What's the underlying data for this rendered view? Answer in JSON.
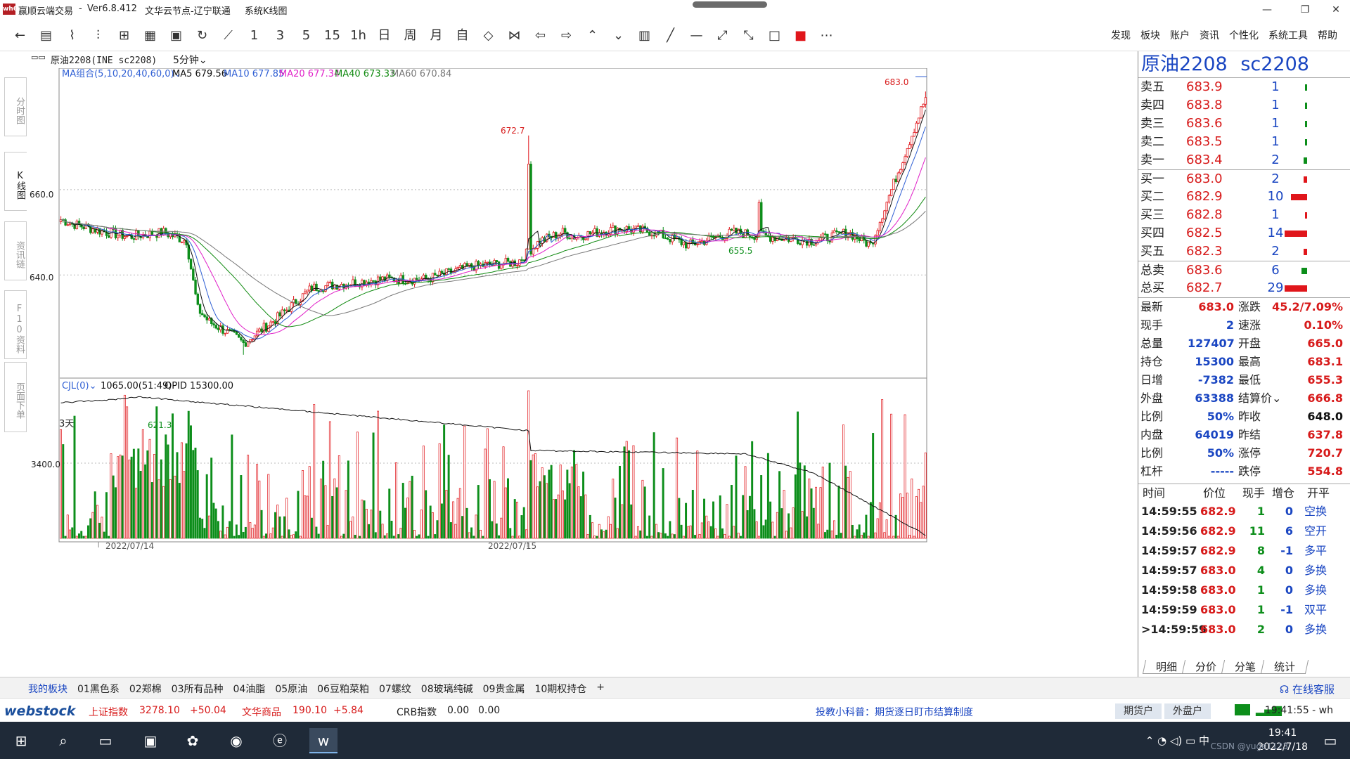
{
  "window": {
    "logo_text": "wh6",
    "app_name": "赢顺云端交易",
    "version": "Ver6.8.412",
    "node": "文华云节点-辽宁联通",
    "view": "系统K线图",
    "min": "—",
    "max": "❐",
    "close": "✕"
  },
  "toolbar": {
    "icons": [
      "←",
      "▤",
      "⌇",
      "⫶",
      "⊞",
      "▦",
      "▣",
      "↻",
      "⟋",
      "1",
      "3",
      "5",
      "15",
      "1h",
      "日",
      "周",
      "月",
      "自",
      "◇",
      "⋈",
      "⇦",
      "⇨",
      "⌃",
      "⌄",
      "▥",
      "╱",
      "—",
      "⤢",
      "⤡",
      "□",
      "■",
      "⋯"
    ],
    "menu": [
      "发现",
      "板块",
      "账户",
      "资讯",
      "个性化",
      "系统工具",
      "帮助"
    ]
  },
  "side_tabs": [
    "分时图",
    "K线图",
    "资讯链",
    "F10资料",
    "页面下单"
  ],
  "chart_header": {
    "symbol": "原油2208(INE sc2208)",
    "period": "5分钟⌄",
    "ma_title": "MA组合(5,10,20,40,60,0)⌄",
    "ma5": "MA5  679.56",
    "ma10": "MA10  677.85",
    "ma20": "MA20  677.34",
    "ma40": "MA40  673.33",
    "ma60": "MA60  670.84"
  },
  "chart_data": {
    "type": "candlestick",
    "price_axis_ticks": [
      "660.0",
      "640.0"
    ],
    "price_ticks_values": [
      660,
      640
    ],
    "price_range": [
      616,
      686
    ],
    "high_label": "683.0",
    "spike_label": "672.7",
    "low_label": "621.3",
    "dip_label": "655.5",
    "days_label": "3天",
    "dates": [
      "2022/07/14",
      "2022/07/15"
    ],
    "date_index": [
      17,
      205
    ],
    "bar_count": 380,
    "series": [
      {
        "name": "MA5",
        "color": "#111111"
      },
      {
        "name": "MA10",
        "color": "#2f5fd4"
      },
      {
        "name": "MA20",
        "color": "#e020c8"
      },
      {
        "name": "MA40",
        "color": "#108a10"
      },
      {
        "name": "MA60",
        "color": "#777777"
      }
    ],
    "close_path": [
      [
        0,
        653
      ],
      [
        5,
        652
      ],
      [
        20,
        650
      ],
      [
        30,
        649
      ],
      [
        45,
        650
      ],
      [
        55,
        648
      ],
      [
        60,
        632
      ],
      [
        65,
        629
      ],
      [
        75,
        626
      ],
      [
        80,
        624
      ],
      [
        95,
        630
      ],
      [
        110,
        637
      ],
      [
        125,
        638
      ],
      [
        140,
        639
      ],
      [
        160,
        639
      ],
      [
        180,
        642
      ],
      [
        200,
        643
      ],
      [
        210,
        648
      ],
      [
        220,
        650
      ],
      [
        225,
        649
      ],
      [
        245,
        651
      ],
      [
        260,
        650
      ],
      [
        275,
        647
      ],
      [
        295,
        650
      ],
      [
        310,
        649
      ],
      [
        330,
        648
      ],
      [
        345,
        650
      ],
      [
        355,
        647
      ],
      [
        380,
        683
      ]
    ],
    "vol_label": "CJL(0)⌄",
    "vol_value": "1065.00(51:49)",
    "opid": "OPID 15300.00",
    "vol_axis_tick": "3400.0"
  },
  "quote": {
    "name": "原油2208",
    "code": "sc2208",
    "sells": [
      {
        "name": "卖五",
        "price": "683.9",
        "vol": "1",
        "frac": 0.04
      },
      {
        "name": "卖四",
        "price": "683.8",
        "vol": "1",
        "frac": 0.04
      },
      {
        "name": "卖三",
        "price": "683.6",
        "vol": "1",
        "frac": 0.04
      },
      {
        "name": "卖二",
        "price": "683.5",
        "vol": "1",
        "frac": 0.04
      },
      {
        "name": "卖一",
        "price": "683.4",
        "vol": "2",
        "frac": 0.08
      }
    ],
    "buys": [
      {
        "name": "买一",
        "price": "683.0",
        "vol": "2",
        "frac": 0.08
      },
      {
        "name": "买二",
        "price": "682.9",
        "vol": "10",
        "frac": 0.4
      },
      {
        "name": "买三",
        "price": "682.8",
        "vol": "1",
        "frac": 0.04
      },
      {
        "name": "买四",
        "price": "682.5",
        "vol": "14",
        "frac": 0.55
      },
      {
        "name": "买五",
        "price": "682.3",
        "vol": "2",
        "frac": 0.08
      }
    ],
    "totals": [
      {
        "name": "总卖",
        "price": "683.6",
        "vol": "6",
        "frac": 0.14,
        "green": true
      },
      {
        "name": "总买",
        "price": "682.7",
        "vol": "29",
        "frac": 0.55,
        "green": false
      }
    ],
    "stats": [
      {
        "l": "最新",
        "lv": "683.0",
        "r": "涨跌",
        "rv": "45.2/7.09%"
      },
      {
        "l": "现手",
        "lv": "2",
        "r": "速涨",
        "rv": "0.10%"
      },
      {
        "l": "总量",
        "lv": "127407",
        "r": "开盘",
        "rv": "665.0"
      },
      {
        "l": "持仓",
        "lv": "15300",
        "r": "最高",
        "rv": "683.1"
      },
      {
        "l": "日增",
        "lv": "-7382",
        "r": "最低",
        "rv": "655.3"
      },
      {
        "l": "外盘",
        "lv": "63388",
        "r": "结算价⌄",
        "rv": "666.8"
      },
      {
        "l": "比例",
        "lv": "50%",
        "r": "昨收",
        "rv": "648.0"
      },
      {
        "l": "内盘",
        "lv": "64019",
        "r": "昨结",
        "rv": "637.8"
      },
      {
        "l": "比例",
        "lv": "50%",
        "r": "涨停",
        "rv": "720.7"
      },
      {
        "l": "杠杆",
        "lv": "-----",
        "r": "跌停",
        "rv": "554.8"
      }
    ],
    "tick_headers": [
      "时间",
      "价位",
      "现手",
      "增仓",
      "开平"
    ],
    "ticks": [
      {
        "t": "14:59:55",
        "p": "682.9",
        "v": "1",
        "z": "0",
        "k": "空换"
      },
      {
        "t": "14:59:56",
        "p": "682.9",
        "v": "11",
        "z": "6",
        "k": "空开"
      },
      {
        "t": "14:59:57",
        "p": "682.9",
        "v": "8",
        "z": "-1",
        "k": "多平"
      },
      {
        "t": "14:59:57",
        "p": "683.0",
        "v": "4",
        "z": "0",
        "k": "多换"
      },
      {
        "t": "14:59:58",
        "p": "683.0",
        "v": "1",
        "z": "0",
        "k": "多换"
      },
      {
        "t": "14:59:59",
        "p": "683.0",
        "v": "1",
        "z": "-1",
        "k": "双平"
      },
      {
        "t": ">14:59:59",
        "p": "683.0",
        "v": "2",
        "z": "0",
        "k": "多换"
      }
    ],
    "tabs": [
      "明细",
      "分价",
      "分笔",
      "统计"
    ]
  },
  "blocks": [
    "我的板块",
    "01黑色系",
    "02郑棉",
    "03所有品种",
    "04油脂",
    "05原油",
    "06豆粕菜粕",
    "07螺纹",
    "08玻璃纯碱",
    "09贵金属",
    "10期权持仓",
    "+"
  ],
  "service": "在线客服",
  "status": {
    "logo": "webstock",
    "sh_name": "上证指数",
    "sh_val": "3278.10",
    "sh_chg": "+50.04",
    "wh_name": "文华商品",
    "wh_val": "190.10",
    "wh_chg": "+5.84",
    "crb_name": "CRB指数",
    "crb_val": "0.00",
    "crb_chg": "0.00",
    "tip": "投教小科普：期货逐日盯市结算制度",
    "btn1": "期货户",
    "btn2": "外盘户",
    "time": "19:41:55 - wh"
  },
  "taskbar": {
    "ime": "中",
    "time": "19:41",
    "date": "2022/7/18",
    "watermark": "CSDN @yuge1123"
  },
  "colors": {
    "up": "#e0161b",
    "down": "#0c8e1a",
    "accent": "#1a46c2"
  }
}
